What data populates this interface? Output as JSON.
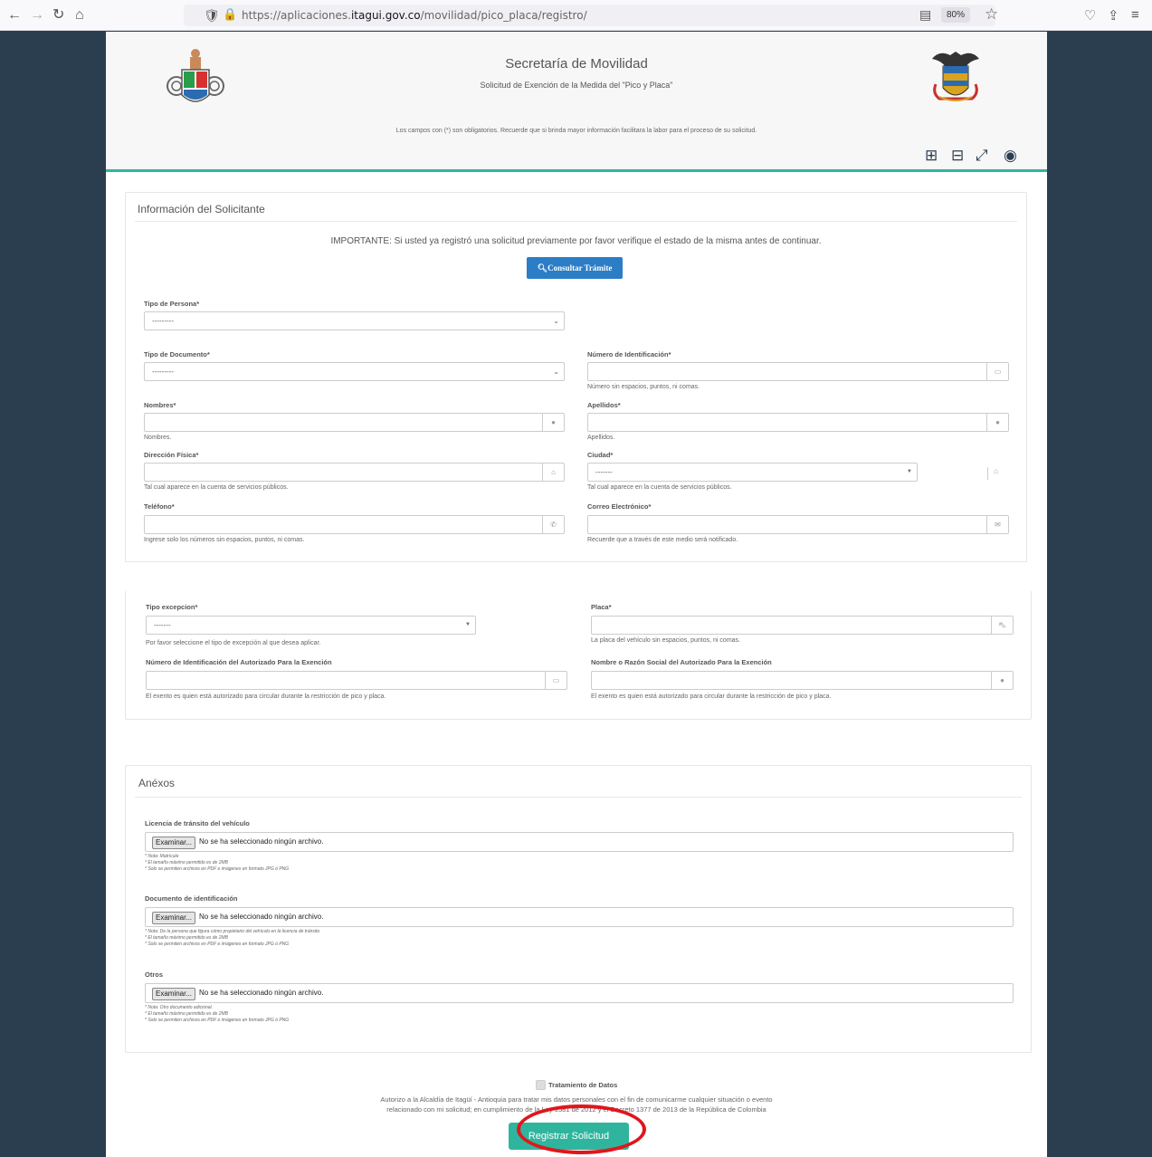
{
  "browser": {
    "url_prefix": "https://aplicaciones.",
    "url_domain": "itagui.gov.co",
    "url_path": "/movilidad/pico_placa/registro/",
    "zoom": "80%"
  },
  "header": {
    "title": "Secretaría de Movilidad",
    "subtitle": "Solicitud de Exención de la Medida del \"Pico y Placa\"",
    "note": "Los campos con (*) son obligatorios. Recuerde que si brinda mayor información facilitara la labor para el proceso de su solicitud."
  },
  "applicant": {
    "title": "Información del Solicitante",
    "important": "IMPORTANTE: Si usted ya registró una solicitud previamente por favor verifique el estado de la misma antes de continuar.",
    "consult_button": "Consultar Trámite",
    "tipo_persona": {
      "label": "Tipo de Persona*",
      "value": "---------"
    },
    "tipo_documento": {
      "label": "Tipo de Documento*",
      "value": "---------"
    },
    "numero_identificacion": {
      "label": "Número de Identificación*",
      "help": "Número sin espacios, puntos, ni comas."
    },
    "nombres": {
      "label": "Nombres*",
      "help": "Nombres."
    },
    "apellidos": {
      "label": "Apellidos*",
      "help": "Apellidos."
    },
    "direccion": {
      "label": "Dirección Física*",
      "help": "Tal cual aparece en la cuenta de servicios públicos."
    },
    "ciudad": {
      "label": "Ciudad*",
      "value": "-------",
      "help": "Tal cual aparece en la cuenta de servicios públicos."
    },
    "telefono": {
      "label": "Teléfono*",
      "help": "Ingrese solo los números sin espacios, puntos, ni comas."
    },
    "correo": {
      "label": "Correo Electrónico*",
      "help": "Recuerde que a través de este medio será notificado."
    }
  },
  "exception": {
    "tipo": {
      "label": "Tipo excepcion*",
      "value": "-------",
      "help": "Por favor seleccione el tipo de excepción al que desea aplicar."
    },
    "placa": {
      "label": "Placa*",
      "help": "La placa del vehículo sin espacios, puntos, ni comas."
    },
    "num_autorizado": {
      "label": "Número de Identificación del Autorizado Para la Exención",
      "help": "El exento es quien está autorizado para circular durante la restricción de pico y placa."
    },
    "nombre_autorizado": {
      "label": "Nombre o Razón Social del Autorizado Para la Exención",
      "help": "El exento es quien está autorizado para circular durante la restricción de pico y placa."
    }
  },
  "annexes": {
    "title": "Anéxos",
    "browse_label": "Examinar...",
    "no_file": "No se ha seleccionado ningún archivo.",
    "licencia": {
      "label": "Licencia de tránsito del vehículo",
      "note1": "* Nota: Matrícula",
      "note2": "* El tamaño máximo permitido es de 2MB",
      "note3": "* Solo se permiten archivos en PDF e imágenes en formato JPG ó PNG"
    },
    "documento": {
      "label": "Documento de identificación",
      "note1": "* Nota: De la persona que figura cómo propietario del vehículo en la licencia de tránsito",
      "note2": "* El tamaño máximo permitido es de 2MB",
      "note3": "* Solo se permiten archivos en PDF e imágenes en formato JPG ó PNG"
    },
    "otros": {
      "label": "Otros",
      "note1": "* Nota: Otro documento adicional.",
      "note2": "* El tamaño máximo permitido es de 2MB",
      "note3": "* Solo se permiten archivos en PDF e imágenes en formato JPG ó PNG"
    }
  },
  "consent": {
    "label": "Tratamiento de Datos",
    "line1": "Autorizo a la Alcaldía de Itagüí - Antioquia para tratar mis datos personales con el fin de comunicarme cualquier situación o evento",
    "line2": "relacionado con mi solicitud; en cumplimiento de la Ley 1581 de 2012 y el Decreto 1377 de 2013 de la República de Colombia"
  },
  "submit_button": "Registrar Solicitud",
  "colors": {
    "accent": "#2fb59d",
    "primary": "#2b7dc5",
    "background": "#2b3e50",
    "highlight": "#e0161c"
  }
}
